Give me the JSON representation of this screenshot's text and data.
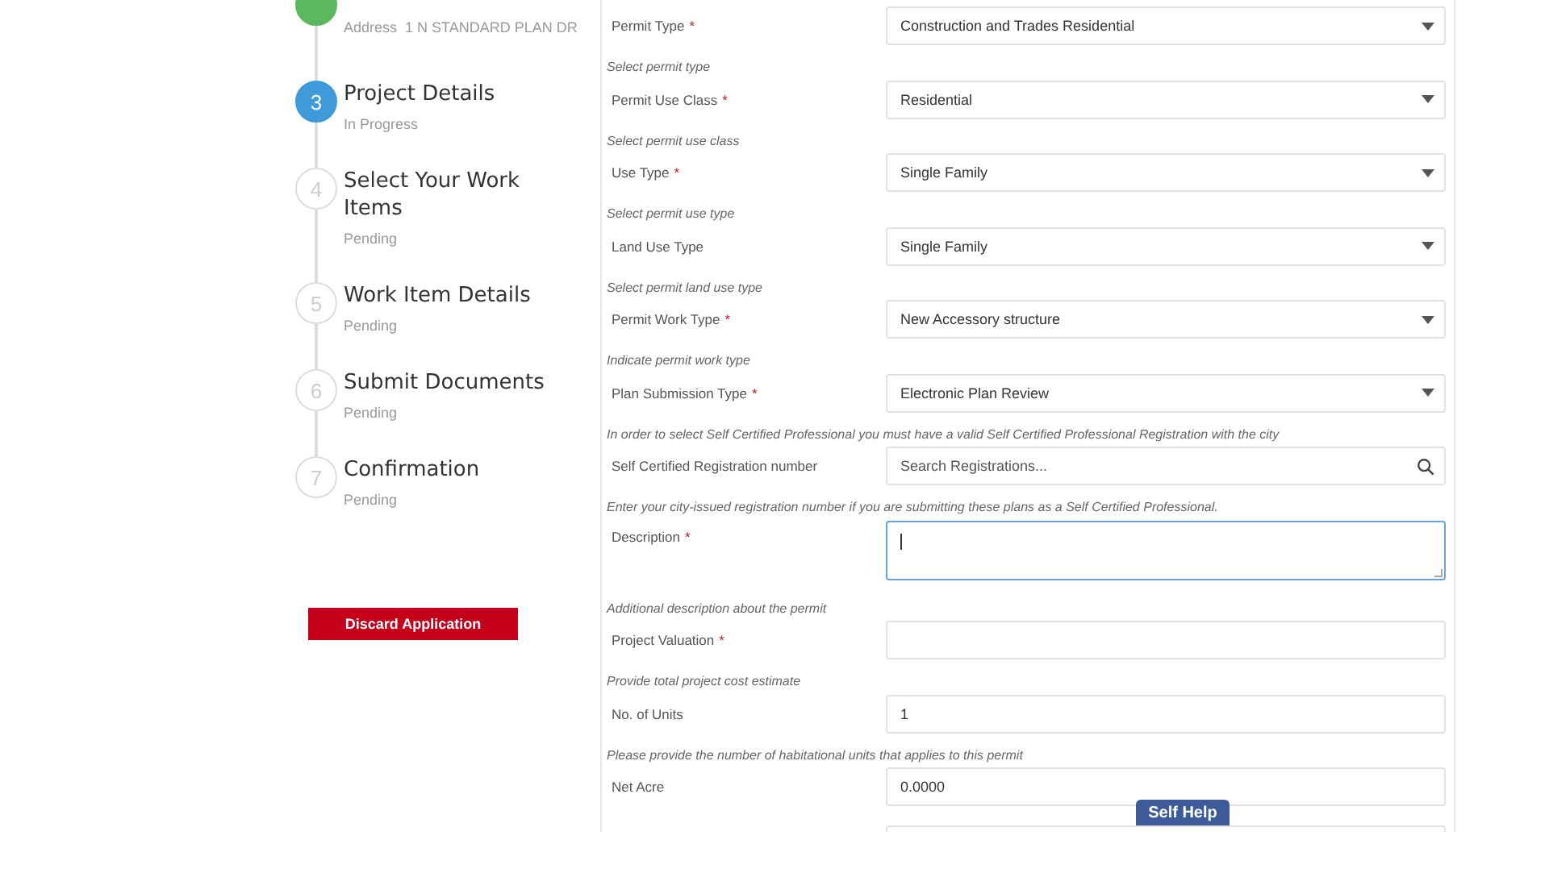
{
  "steps": [
    {
      "completed": true,
      "current": false,
      "detail_label": "Address",
      "detail_value": "1 N STANDARD PLAN DR"
    },
    {
      "number": "3",
      "completed": false,
      "current": true,
      "title": "Project Details",
      "status": "In Progress"
    },
    {
      "number": "4",
      "completed": false,
      "current": false,
      "title": "Select Your Work Items",
      "status": "Pending"
    },
    {
      "number": "5",
      "completed": false,
      "current": false,
      "title": "Work Item Details",
      "status": "Pending"
    },
    {
      "number": "6",
      "completed": false,
      "current": false,
      "title": "Submit Documents",
      "status": "Pending"
    },
    {
      "number": "7",
      "completed": false,
      "current": false,
      "title": "Confirmation",
      "status": "Pending"
    }
  ],
  "discard_button": "Discard Application",
  "fields": [
    {
      "kind": "select",
      "label": "Permit Type",
      "required_mark": "*",
      "value": "Construction and Trades Residential",
      "hint": "Select permit type"
    },
    {
      "kind": "select",
      "label": "Permit Use Class",
      "required_mark": "*",
      "value": "Residential",
      "hint": "Select permit use class"
    },
    {
      "kind": "select",
      "label": "Use Type",
      "required_mark": "*",
      "value": "Single Family",
      "hint": "Select permit use type"
    },
    {
      "kind": "select",
      "label": "Land Use Type",
      "value": "Single Family",
      "hint": "Select permit land use type"
    },
    {
      "kind": "select",
      "label": "Permit Work Type",
      "required_mark": "*",
      "value": "New Accessory structure",
      "hint": "Indicate permit work type"
    },
    {
      "kind": "select",
      "label": "Plan Submission Type",
      "required_mark": "*",
      "value": "Electronic Plan Review",
      "hint": "In order to select Self Certified Professional you must have a valid Self Certified Professional Registration with the city"
    },
    {
      "kind": "search",
      "label": "Self Certified Registration number",
      "placeholder": "Search Registrations...",
      "hint": "Enter your city-issued registration number if you are submitting these plans as a Self Certified Professional."
    },
    {
      "kind": "textarea",
      "label": "Description",
      "required_mark": "*",
      "focused": true,
      "hint": "Additional description about the permit"
    },
    {
      "kind": "text",
      "label": "Project Valuation",
      "required_mark": "*",
      "hint": "Provide total project cost estimate"
    },
    {
      "kind": "text",
      "label": "No. of Units",
      "value": "1",
      "hint": "Please provide the number of habitational units that applies to this permit"
    },
    {
      "kind": "text",
      "label": "Net Acre",
      "value": "0.0000"
    },
    {
      "kind": "text"
    }
  ],
  "self_help_button": "Self Help"
}
